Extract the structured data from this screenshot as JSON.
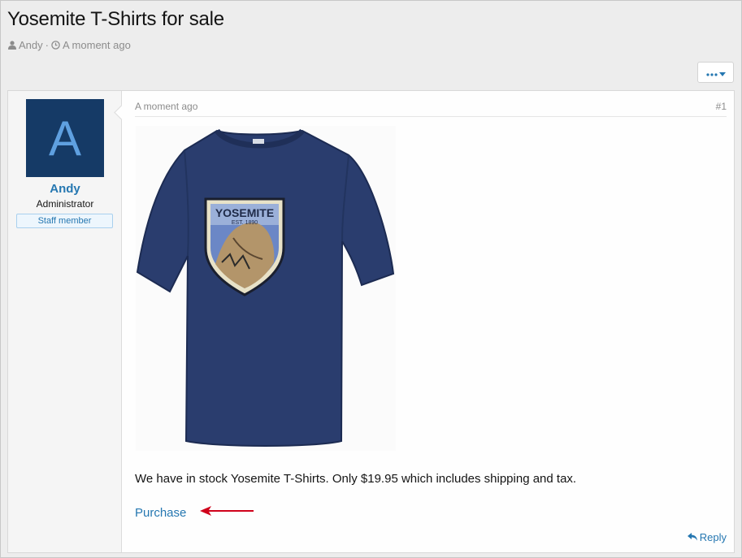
{
  "thread": {
    "title": "Yosemite T-Shirts for sale",
    "author": "Andy",
    "separator": "·",
    "time": "A moment ago"
  },
  "toolbar": {
    "more_button_icon": "more-dots-icon"
  },
  "post": {
    "user": {
      "avatar_letter": "A",
      "name": "Andy",
      "role": "Administrator",
      "badge": "Staff member"
    },
    "date": "A moment ago",
    "number": "#1",
    "image_alt": "YOSEMITE EST. 1890",
    "image_title": "YOSEMITE",
    "image_sub": "EST. 1890",
    "body_text": "We have in stock Yosemite T-Shirts. Only $19.95 which includes shipping and tax.",
    "purchase_link": "Purchase",
    "reply_label": "Reply"
  },
  "colors": {
    "accent": "#2577b1",
    "avatar_bg": "#153a66",
    "arrow": "#d0021b"
  }
}
